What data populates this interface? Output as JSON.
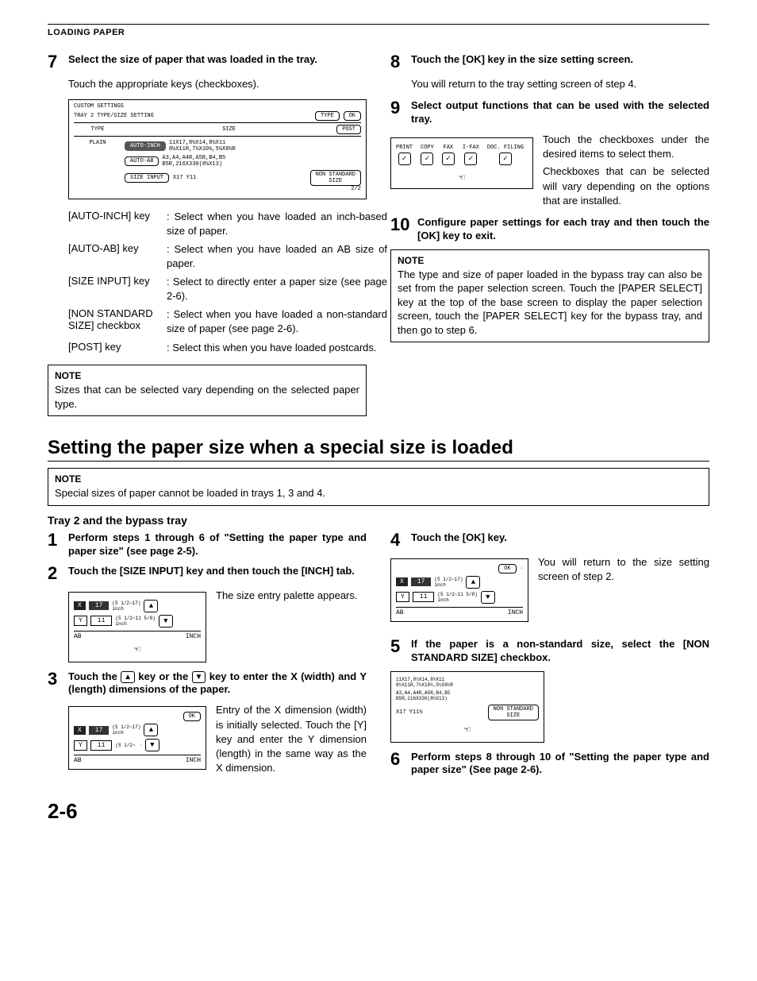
{
  "header": {
    "title": "LOADING PAPER"
  },
  "left": {
    "step7": {
      "num": "7",
      "title": "Select the size of paper that was loaded in the tray.",
      "body": "Touch the appropriate keys (checkboxes)."
    },
    "panel": {
      "custom": "CUSTOM SETTINGS",
      "trayline": "TRAY 2 TYPE/SIZE SETTING",
      "type_btn": "TYPE",
      "ok_btn": "OK",
      "type_hdr": "TYPE",
      "size_hdr": "SIZE",
      "post_btn": "POST",
      "plain": "PLAIN",
      "auto_inch": "AUTO-INCH",
      "auto_inch_sizes": "11X17,8½X14,8½X11\n8½X11R,7½X10½,5½X8½R",
      "auto_ab": "AUTO-AB",
      "auto_ab_sizes": "A3,A4,A4R,A5R,B4,B5\nB5R,216X330(8½X13)",
      "size_input": "SIZE INPUT",
      "size_input_values": "X17   Y11",
      "nonstd": "NON STANDARD\nSIZE",
      "page": "2/2"
    },
    "keys": [
      {
        "name": "[AUTO-INCH] key",
        "desc": ": Select when you have loaded an inch-based size of paper."
      },
      {
        "name": "[AUTO-AB] key",
        "desc": ": Select when you have loaded an AB size of paper."
      },
      {
        "name": "[SIZE INPUT] key",
        "desc": ": Select to directly enter a paper size (see page 2-6)."
      },
      {
        "name": "[NON STANDARD SIZE] checkbox",
        "desc": ": Select when you have loaded a non-standard size of paper (see page 2-6)."
      },
      {
        "name": "[POST] key",
        "desc": ": Select this when you have loaded postcards."
      }
    ],
    "note": {
      "title": "NOTE",
      "body": "Sizes that can be selected vary depending on the selected paper type."
    }
  },
  "right": {
    "step8": {
      "num": "8",
      "title": "Touch the [OK] key in the size setting screen.",
      "body": "You will return to the tray setting screen of step 4."
    },
    "step9": {
      "num": "9",
      "title": "Select output functions that can be used with the selected tray.",
      "cbx": [
        "PRINT",
        "COPY",
        "FAX",
        "I-FAX",
        "DOC. FILING"
      ],
      "body1": "Touch the checkboxes under the desired items to select them.",
      "body2": "Checkboxes that can be selected will vary depending on the options that are installed."
    },
    "step10": {
      "num": "10",
      "title": "Configure paper settings for each tray and then touch the [OK] key to exit."
    },
    "note": {
      "title": "NOTE",
      "body": "The type and size of paper loaded in the bypass tray can also be set from the paper selection screen. Touch the [PAPER SELECT] key at the top of the base screen to display the paper selection screen, touch the [PAPER SELECT] key for the bypass tray, and then go to step 6."
    }
  },
  "section2": {
    "heading": "Setting the paper size when a special size is loaded",
    "note": {
      "title": "NOTE",
      "body": "Special sizes of paper cannot be loaded in trays 1, 3 and 4."
    },
    "sub": "Tray 2 and the bypass tray",
    "left": {
      "step1": {
        "num": "1",
        "title": "Perform steps 1 through 6 of \"Setting the paper type and paper size\" (see page 2-5)."
      },
      "step2": {
        "num": "2",
        "title": "Touch the [SIZE INPUT] key and then touch the [INCH] tab.",
        "body": "The size entry palette appears."
      },
      "step3": {
        "num": "3",
        "title_a": "Touch the ",
        "title_b": " key or the ",
        "title_c": " key to enter the X (width) and Y (length) dimensions of the paper.",
        "body": "Entry of the X dimension (width) is initially selected. Touch the [Y] key and enter the Y dimension (length) in the same way as the X dimension."
      }
    },
    "right": {
      "step4": {
        "num": "4",
        "title": "Touch the [OK] key.",
        "body": "You will return to the size setting screen of step 2."
      },
      "step5": {
        "num": "5",
        "title": "If the paper is a non-standard size, select the [NON STANDARD SIZE] checkbox."
      },
      "step6": {
        "num": "6",
        "title": "Perform steps 8 through 10 of \"Setting the paper type and paper size\" (See page 2-6)."
      }
    },
    "mini": {
      "x": "X",
      "y": "Y",
      "xv": "17",
      "yv": "11",
      "xr": "(5 1/2~17)\ninch",
      "yr": "(5 1/2~11 5/8)\ninch",
      "ab": "AB",
      "inch": "INCH",
      "ok": "OK"
    },
    "panel5": {
      "line1": "11X17,8½X14,8½X11\n8½X11R,7½X10½,5½X8½R",
      "line2": "A3,A4,A4R,A5R,B4,B5\nB5R,216X330(8½X13)",
      "xy": "X17   Y11½",
      "nonstd": "NON STANDARD\nSIZE"
    }
  },
  "pagenum": "2-6"
}
